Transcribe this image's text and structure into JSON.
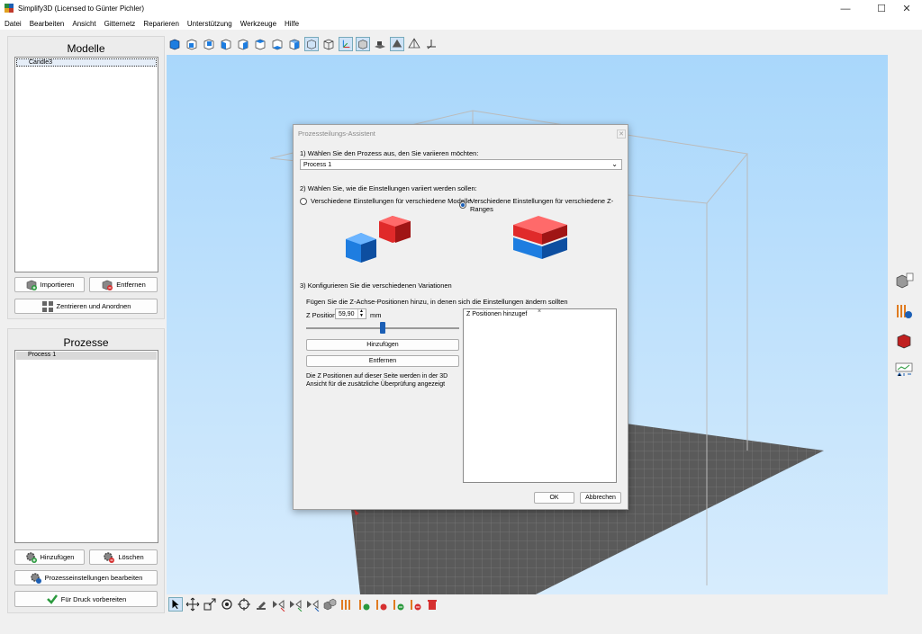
{
  "window": {
    "title": "Simplify3D (Licensed to Günter Pichler)"
  },
  "menu": [
    "Datei",
    "Bearbeiten",
    "Ansicht",
    "Gitternetz",
    "Reparieren",
    "Unterstützung",
    "Werkzeuge",
    "Hilfe"
  ],
  "models_panel": {
    "title": "Modelle",
    "items": [
      "Candle3"
    ],
    "import_label": "Importieren",
    "remove_label": "Entfernen",
    "center_label": "Zentrieren und Anordnen"
  },
  "process_panel": {
    "title": "Prozesse",
    "items": [
      "Process 1"
    ],
    "add_label": "Hinzufügen",
    "delete_label": "Löschen",
    "edit_label": "Prozesseinstellungen bearbeiten",
    "prepare_label": "Für Druck vorbereiten"
  },
  "dialog": {
    "title": "Prozessteilungs-Assistent",
    "step1": "1) Wählen Sie den Prozess aus, den Sie variieren möchten:",
    "process_value": "Process 1",
    "step2": "2) Wählen Sie, wie die Einstellungen variiert werden sollen:",
    "option_models": "Verschiedene Einstellungen für verschiedene Modelle",
    "option_zranges": "Verschiedene Einstellungen für verschiedene Z-Ranges",
    "step3": "3) Konfigurieren Sie die verschiedenen Variationen",
    "hint": "Fügen Sie die Z-Achse-Positionen hinzu, in denen sich die Einstellungen ändern sollten",
    "zpos_label": "Z Position",
    "zpos_value": "59,90",
    "zpos_unit": "mm",
    "slider_fraction": 0.5,
    "add_label": "Hinzufügen",
    "remove_label": "Entfernen",
    "info": "Die Z Positionen auf dieser Seite werden in der 3D Ansicht für die zusätzliche Überprüfung angezeigt",
    "zlist_placeholder": "Z Positionen hinzugef",
    "ok_label": "OK",
    "cancel_label": "Abbrechen"
  },
  "colors": {
    "accent": "#1c5fb5",
    "cube_blue": "#1e7de0",
    "cube_red": "#e02a2a",
    "viewport_top": "#a9d7fb"
  }
}
